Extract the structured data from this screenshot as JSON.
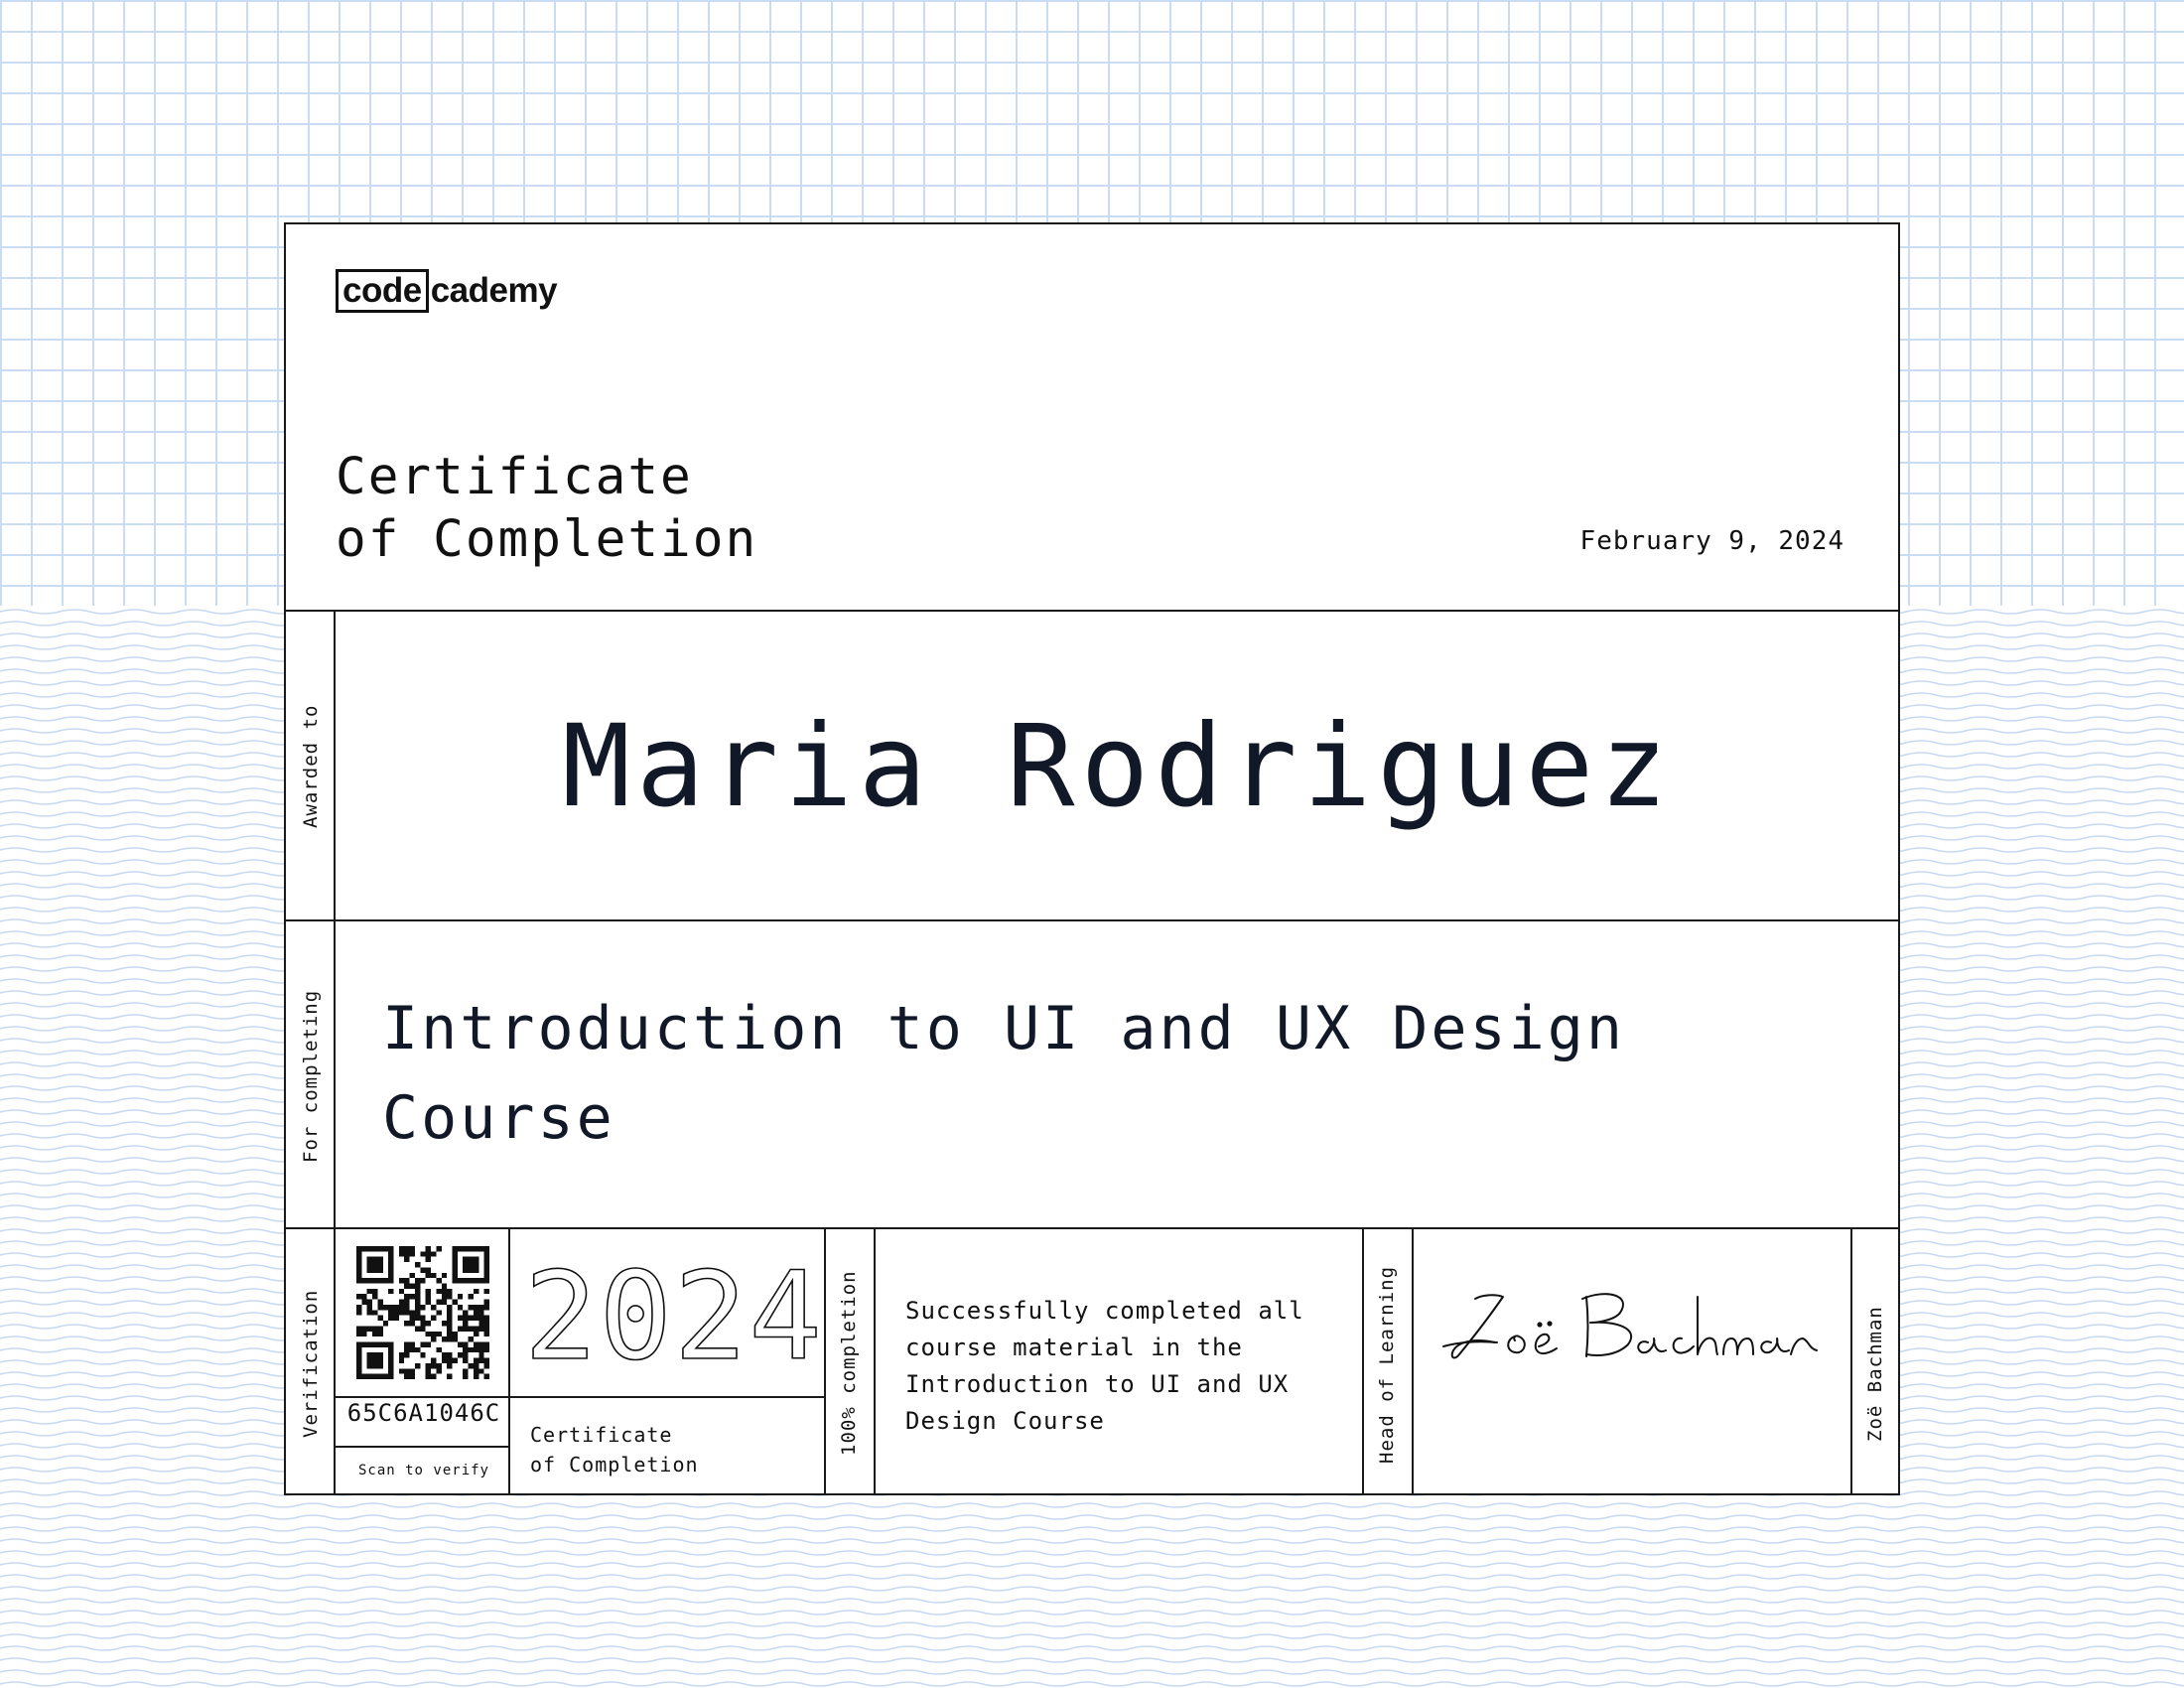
{
  "brand": {
    "logo_boxed": "code",
    "logo_rest": "cademy"
  },
  "certificate": {
    "title_line1": "Certificate",
    "title_line2": "of Completion",
    "date": "February 9, 2024",
    "awarded_label": "Awarded to",
    "recipient": "Maria Rodriguez",
    "for_label": "For completing",
    "course": "Introduction to UI and UX Design Course"
  },
  "footer": {
    "verification_label": "Verification",
    "verification_code": "65C6A1046C",
    "scan_label": "Scan to verify",
    "year": "2024",
    "small_title_line1": "Certificate",
    "small_title_line2": "of Completion",
    "completion_label": "100% completion",
    "description_lines": [
      "Successfully completed all",
      "course material in the",
      "Introduction to UI and UX",
      "Design Course"
    ],
    "signer_role": "Head of Learning",
    "signer_name": "Zoë Bachman"
  },
  "colors": {
    "ink": "#111827",
    "border": "#1a1a1a",
    "grid": "#c9dcf3",
    "waves": "#c6d9f2"
  },
  "icons": {
    "qr": "qr-code-icon",
    "signature": "handwritten-signature"
  }
}
